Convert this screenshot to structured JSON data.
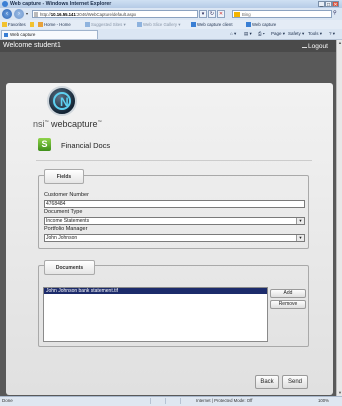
{
  "window": {
    "title": "Web capture - Windows Internet Explorer",
    "controls": {
      "minimize": "_",
      "maximize": "□",
      "close": "✕"
    }
  },
  "address_bar": {
    "url_prefix": "http://",
    "url_host": "10.16.55.141",
    "url_rest": ":2046/WebCapture/default.aspx",
    "refresh": "↻",
    "stop": "✕",
    "search_placeholder": "Bing"
  },
  "favorites_bar": {
    "label": "Favorites",
    "items": [
      {
        "label": "Home - Home"
      },
      {
        "label": "Suggested Sites ▾",
        "disabled": true
      },
      {
        "label": "Web Slice Gallery ▾",
        "disabled": true
      },
      {
        "label": "Web capture client"
      },
      {
        "label": "Web capture"
      }
    ]
  },
  "tabs": [
    {
      "label": "Web capture"
    }
  ],
  "command_bar": {
    "items": [
      "Page ▾",
      "Safety ▾",
      "Tools ▾",
      "? ▾"
    ]
  },
  "app": {
    "welcome": "Welcome student1",
    "logout": "Logout",
    "brand_prefix": "nsi",
    "brand_name": "webcapture",
    "doc_icon_letter": "S",
    "title": "Financial Docs",
    "fields_legend": "Fields",
    "fields": {
      "customer_number_label": "Customer Number",
      "customer_number_value": "4768484",
      "document_type_label": "Document Type",
      "document_type_value": "Income Statements",
      "portfolio_manager_label": "Portfolio Manager",
      "portfolio_manager_value": "John Johnson"
    },
    "documents_legend": "Documents",
    "documents": [
      "John Johnson bank statement.tif"
    ],
    "add_button": "Add",
    "remove_button": "Remove",
    "back_button": "Back",
    "send_button": "Send"
  },
  "status_bar": {
    "text": "Done",
    "zone": "Internet | Protected Mode: Off",
    "zoom": "100%"
  },
  "colors": {
    "app_header": "#4a4a4a",
    "content_bg": "#595959",
    "selection": "#1c2b6b",
    "doc_icon": "#5cb82a",
    "logo_accent": "#5ed0f0"
  }
}
